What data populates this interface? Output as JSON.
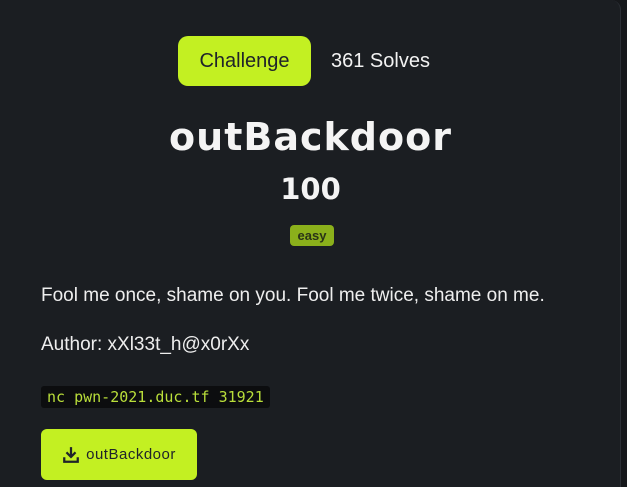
{
  "tabs": {
    "challenge_label": "Challenge",
    "solves_label": "361 Solves"
  },
  "challenge": {
    "name": "outBackdoor",
    "points": "100",
    "tag": "easy",
    "description": "Fool me once, shame on you. Fool me twice, shame on me.",
    "author": "Author: xXl33t_h@x0rXx",
    "connection": "nc pwn-2021.duc.tf 31921"
  },
  "file": {
    "label": "outBackdoor",
    "icon": "download-icon"
  },
  "colors": {
    "accent": "#c3f022",
    "background": "#1b1e22",
    "tag": "#8bb01b",
    "code_text": "#b9de3a"
  }
}
